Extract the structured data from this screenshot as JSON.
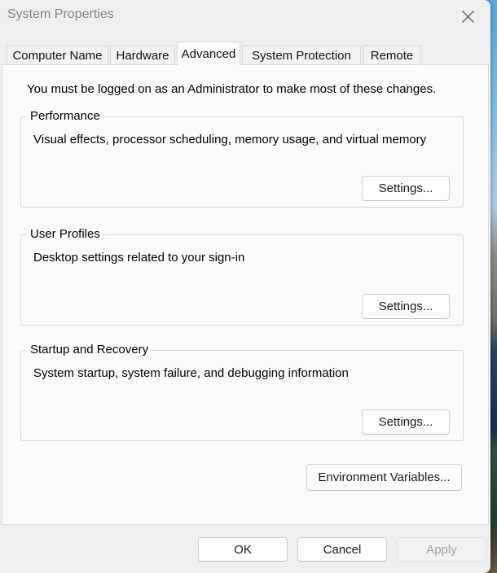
{
  "window": {
    "title": "System Properties"
  },
  "icons": {
    "close": "x-cross"
  },
  "tabs": [
    {
      "label": "Computer Name",
      "active": false
    },
    {
      "label": "Hardware",
      "active": false
    },
    {
      "label": "Advanced",
      "active": true
    },
    {
      "label": "System Protection",
      "active": false
    },
    {
      "label": "Remote",
      "active": false
    }
  ],
  "admin_notice": "You must be logged on as an Administrator to make most of these changes.",
  "groups": [
    {
      "title": "Performance",
      "description": "Visual effects, processor scheduling, memory usage, and virtual memory",
      "button_label": "Settings..."
    },
    {
      "title": "User Profiles",
      "description": "Desktop settings related to your sign-in",
      "button_label": "Settings..."
    },
    {
      "title": "Startup and Recovery",
      "description": "System startup, system failure, and debugging information",
      "button_label": "Settings..."
    }
  ],
  "env_button_label": "Environment Variables...",
  "footer_buttons": {
    "ok": "OK",
    "cancel": "Cancel",
    "apply": "Apply",
    "apply_enabled": false
  },
  "colors": {
    "dialog_bg": "#efefef",
    "page_bg": "#fbfbfb",
    "border": "#d9d9d9",
    "title_text": "#858585",
    "disabled_text": "#a3a3a3"
  }
}
